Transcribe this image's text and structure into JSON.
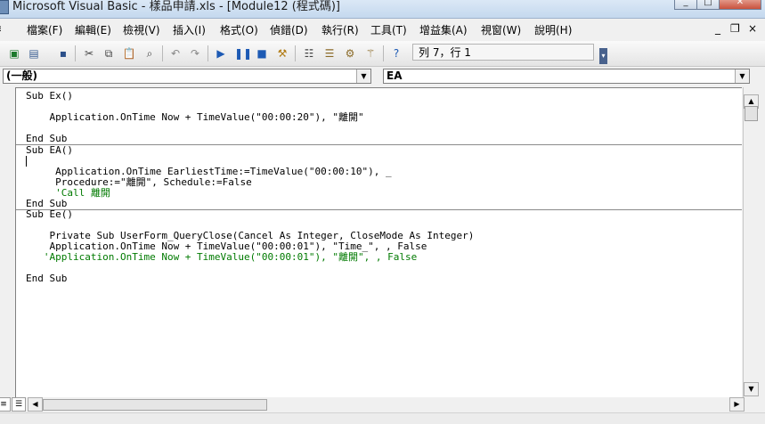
{
  "window": {
    "title": "Microsoft Visual Basic - 樣品申請.xls - [Module12 (程式碼)]",
    "min_glyph": "_",
    "max_glyph": "□",
    "close_glyph": "✕"
  },
  "menu": {
    "items": [
      "檔案(F)",
      "編輯(E)",
      "檢視(V)",
      "插入(I)",
      "格式(O)",
      "偵錯(D)",
      "執行(R)",
      "工具(T)",
      "增益集(A)",
      "視窗(W)",
      "說明(H)"
    ],
    "mdi_min": "_",
    "mdi_restore": "❐",
    "mdi_close": "×"
  },
  "toolbar": {
    "cursor_position": "列 7，行 1"
  },
  "icons": [
    "excel-view-icon",
    "insert-module-icon",
    "save-icon",
    "cut-icon",
    "copy-icon",
    "paste-icon",
    "find-icon",
    "undo-icon",
    "redo-icon",
    "run-icon",
    "break-icon",
    "reset-icon",
    "design-mode-icon",
    "project-explorer-icon",
    "properties-icon",
    "object-browser-icon",
    "toolbox-icon",
    "help-icon"
  ],
  "combos": {
    "object": "(一般)",
    "procedure": "EA"
  },
  "code": [
    {
      "text": "Sub Ex()",
      "type": "code"
    },
    {
      "text": "",
      "type": "code"
    },
    {
      "text": "    Application.OnTime Now + TimeValue(\"00:00:20\"), \"離開\"",
      "type": "code"
    },
    {
      "text": "",
      "type": "code"
    },
    {
      "text": "End Sub",
      "type": "code"
    },
    {
      "text": "Sub EA()",
      "type": "code"
    },
    {
      "text": "",
      "type": "code"
    },
    {
      "text": "     Application.OnTime EarliestTime:=TimeValue(\"00:00:10\"), _",
      "type": "code"
    },
    {
      "text": "     Procedure:=\"離開\", Schedule:=False",
      "type": "code"
    },
    {
      "text": "     'Call 離開",
      "type": "comment"
    },
    {
      "text": "End Sub",
      "type": "code"
    },
    {
      "text": "Sub Ee()",
      "type": "code"
    },
    {
      "text": "",
      "type": "code"
    },
    {
      "text": "    Private Sub UserForm_QueryClose(Cancel As Integer, CloseMode As Integer)",
      "type": "code"
    },
    {
      "text": "    Application.OnTime Now + TimeValue(\"00:00:01\"), \"Time_\", , False",
      "type": "code"
    },
    {
      "text": "   'Application.OnTime Now + TimeValue(\"00:00:01\"), \"離開\", , False",
      "type": "comment"
    },
    {
      "text": "",
      "type": "code"
    },
    {
      "text": "End Sub",
      "type": "code"
    }
  ]
}
